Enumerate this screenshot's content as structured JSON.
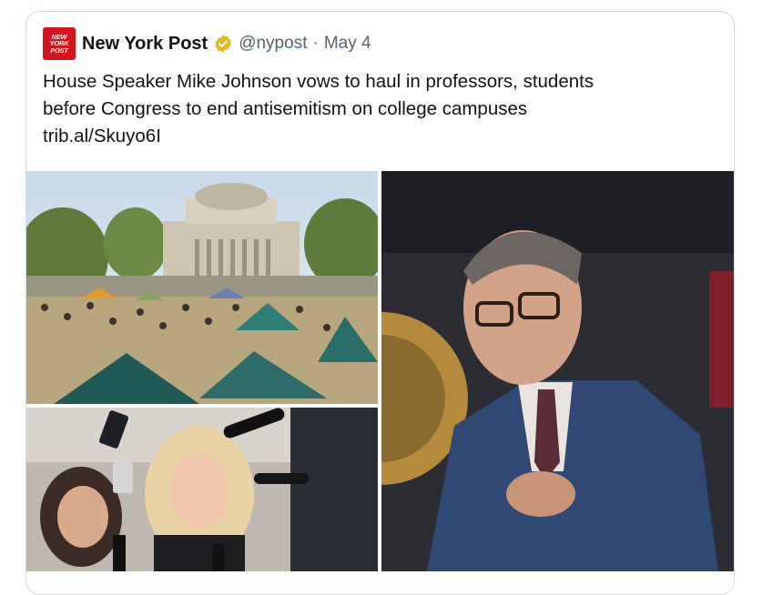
{
  "post": {
    "source_logo_lines": [
      "NEW",
      "YORK",
      "POST"
    ],
    "author_name": "New York Post",
    "verified_icon": "verified-gold-badge-icon",
    "handle": "@nypost",
    "separator": "·",
    "date": "May 4",
    "text_lines": [
      "House Speaker Mike Johnson vows to haul in professors, students",
      "before Congress to end antisemitism on college campuses",
      "trib.al/Skuyo6I"
    ]
  },
  "colors": {
    "brand_red": "#d5151d",
    "verified_gold": "#e2b719",
    "secondary_text": "#536471",
    "border": "#cfd9de"
  },
  "media": {
    "images": [
      {
        "name": "campus-protest-encampment-photo"
      },
      {
        "name": "congresswoman-press-scrum-photo"
      },
      {
        "name": "house-speaker-portrait-photo"
      }
    ]
  }
}
